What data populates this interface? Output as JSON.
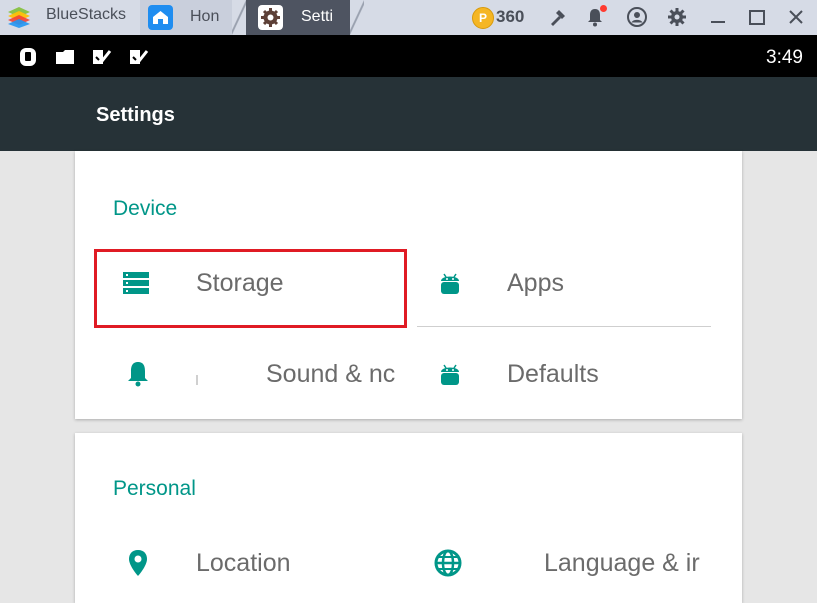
{
  "window": {
    "app_name": "BlueStacks",
    "tabs": [
      {
        "label": "Hon",
        "icon": "home-icon"
      },
      {
        "label": "Setti",
        "icon": "settings-gear-icon"
      }
    ],
    "coins": "360",
    "toolbar_icons": [
      "coin-icon",
      "wrench-icon",
      "bell-icon",
      "account-icon",
      "gear-icon",
      "minimize-icon",
      "maximize-icon",
      "close-icon"
    ]
  },
  "statusbar": {
    "time": "3:49",
    "icons": [
      "shield-icon",
      "folder-icon",
      "check-icon",
      "check-icon"
    ]
  },
  "actionbar": {
    "title": "Settings"
  },
  "device": {
    "title": "Device",
    "items": [
      {
        "label": "Storage",
        "icon": "storage-icon"
      },
      {
        "label": "Apps",
        "icon": "android-icon"
      },
      {
        "label": "Sound & nc",
        "icon": "bell-icon"
      },
      {
        "label": "Defaults",
        "icon": "android-icon"
      }
    ]
  },
  "personal": {
    "title": "Personal",
    "items": [
      {
        "label": "Location",
        "icon": "location-pin-icon"
      },
      {
        "label": "Language & ir",
        "icon": "globe-icon"
      }
    ]
  },
  "colors": {
    "accent": "#009688",
    "toolbar": "#263237",
    "highlight": "#e01b24"
  }
}
